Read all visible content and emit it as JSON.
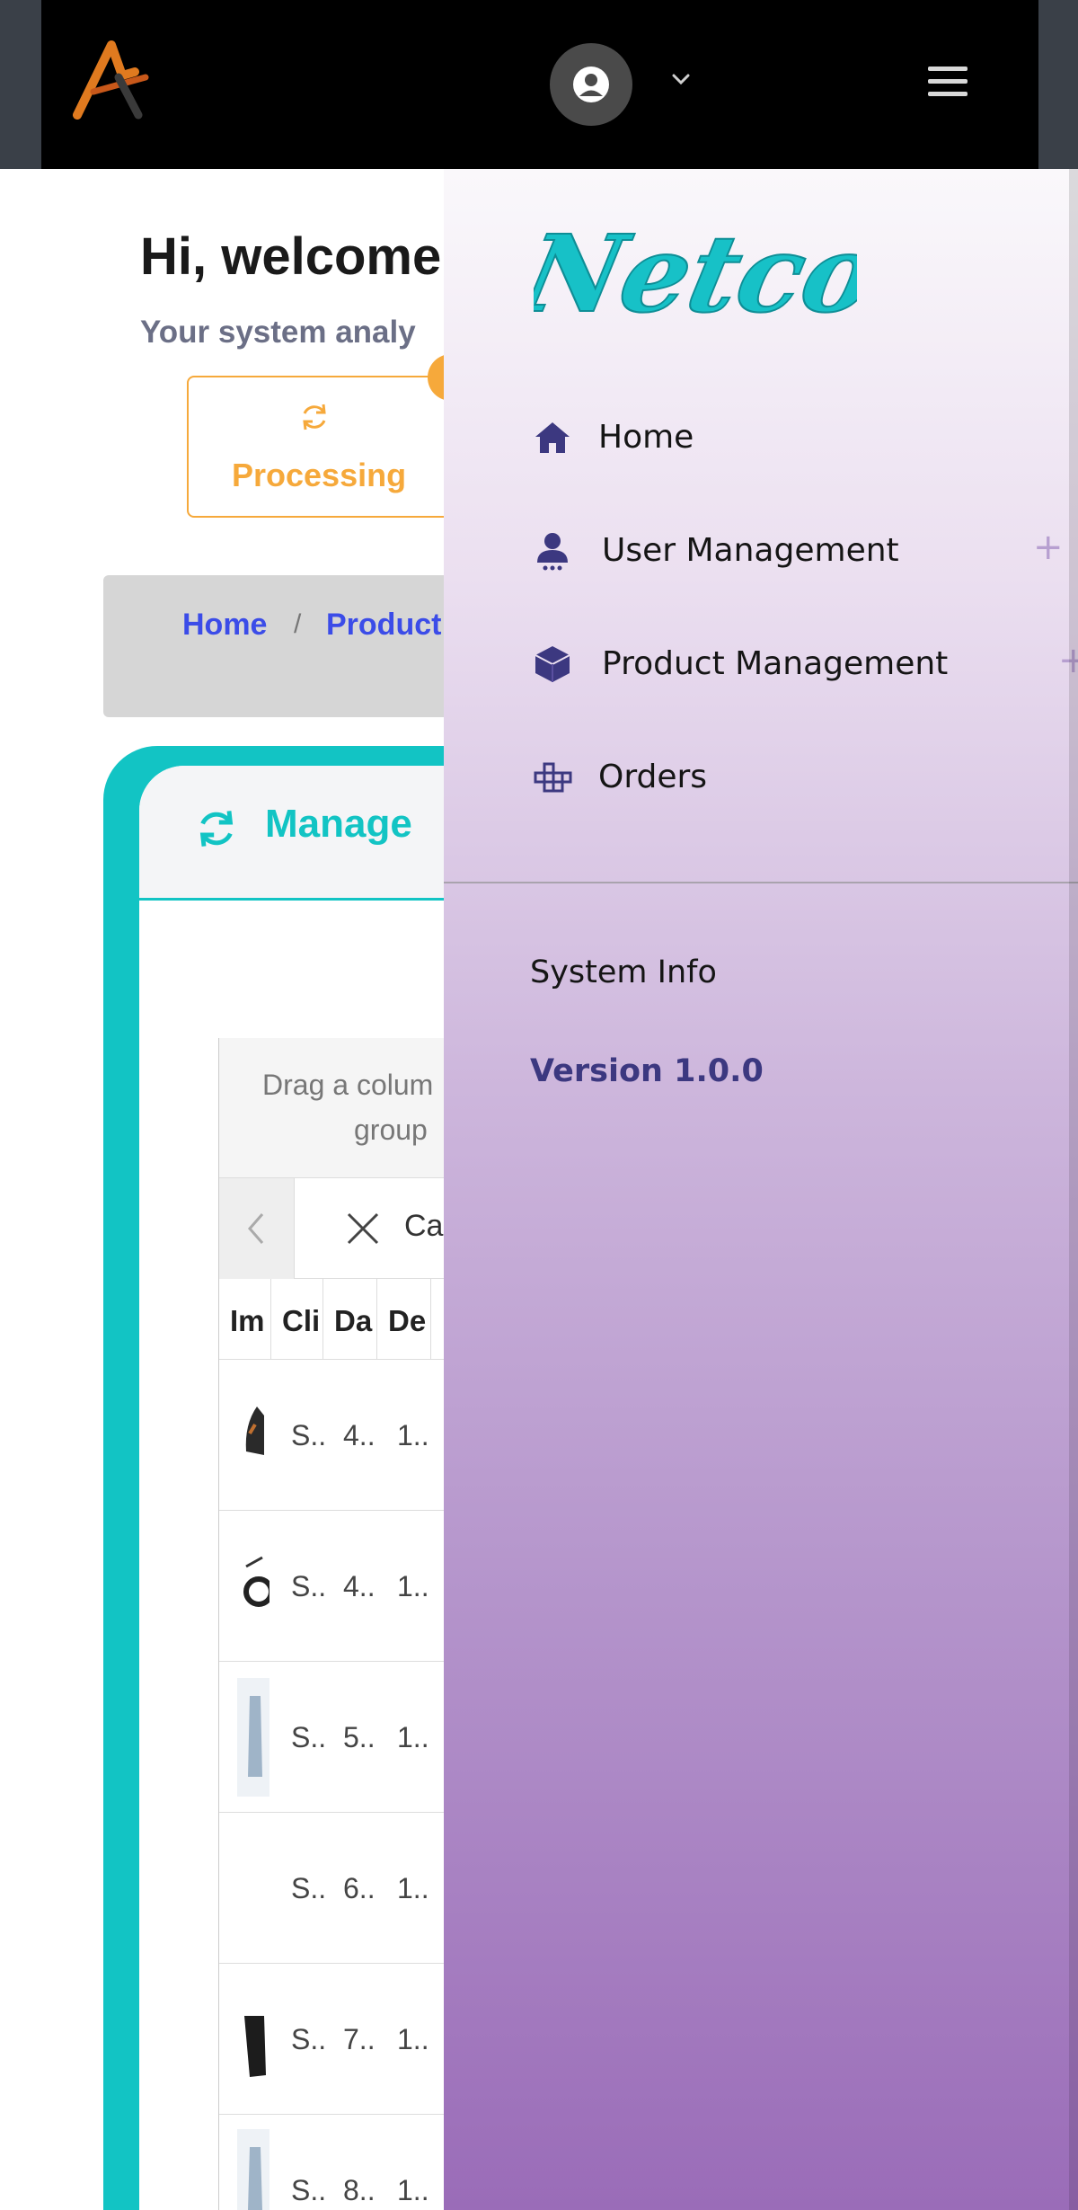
{
  "header": {
    "logo_icon": "stylized-A-logo",
    "user_icon": "user-circle-icon",
    "dropdown_icon": "chevron-down-icon",
    "menu_icon": "hamburger-menu-icon"
  },
  "page": {
    "welcome_title": "Hi, welcome",
    "welcome_subtitle": "Your system analy",
    "status_card": {
      "label": "Processing",
      "icon": "sync-icon",
      "color": "#f6a93b"
    },
    "breadcrumb": {
      "home": "Home",
      "separator": "/",
      "current": "Product"
    },
    "card": {
      "title": "Manage",
      "icon": "sync-icon",
      "accent": "#12c4c4"
    },
    "grid": {
      "group_hint_line1": "Drag a colum",
      "group_hint_line2": "group",
      "cancel_label": "Ca",
      "columns": [
        "Im",
        "Cli",
        "Da",
        "De"
      ],
      "rows": [
        {
          "client": "S..",
          "date": "4..",
          "desc": "1.."
        },
        {
          "client": "S..",
          "date": "4..",
          "desc": "1.."
        },
        {
          "client": "S..",
          "date": "5..",
          "desc": "1.."
        },
        {
          "client": "S..",
          "date": "6..",
          "desc": "1.."
        },
        {
          "client": "S..",
          "date": "7..",
          "desc": "1.."
        },
        {
          "client": "S..",
          "date": "8..",
          "desc": "1.."
        }
      ]
    }
  },
  "drawer": {
    "brand": "Netcode",
    "items": [
      {
        "label": "Home",
        "icon": "home-icon",
        "expandable": false
      },
      {
        "label": "User Management",
        "icon": "user-icon",
        "expandable": true,
        "plus": "+"
      },
      {
        "label": "Product Management",
        "icon": "cube-icon",
        "expandable": true,
        "plus": "+"
      },
      {
        "label": "Orders",
        "icon": "grid-icon",
        "expandable": false
      }
    ],
    "system_info_label": "System Info",
    "version_label": "Version 1.0.0"
  }
}
